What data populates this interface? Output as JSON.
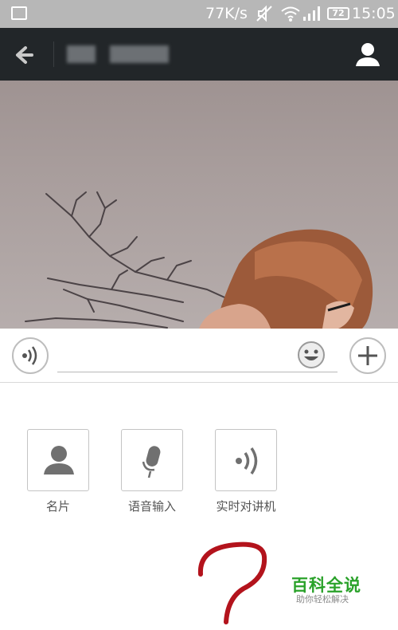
{
  "status_bar": {
    "network_speed": "77K/s",
    "battery": "72",
    "time": "15:05",
    "icons": [
      "image-icon",
      "mute-icon",
      "wifi-icon",
      "signal-icon",
      "battery-icon"
    ]
  },
  "title_bar": {
    "title": "",
    "icons": [
      "back-arrow-icon",
      "profile-icon"
    ]
  },
  "input_bar": {
    "value": "",
    "placeholder": "",
    "icons": [
      "voice-icon",
      "emoji-icon",
      "plus-icon"
    ]
  },
  "panel": {
    "items": [
      {
        "label": "名片",
        "icon": "contact-card-icon"
      },
      {
        "label": "语音输入",
        "icon": "microphone-icon"
      },
      {
        "label": "实时对讲机",
        "icon": "walkie-talkie-icon"
      }
    ]
  },
  "watermark": {
    "title": "百科全说",
    "subtitle": "助你轻松解决"
  },
  "colors": {
    "status_bar": "#b7b7b7",
    "title_bar": "#222629",
    "annotation": "#b3131c",
    "watermark": "#2aa22a"
  }
}
